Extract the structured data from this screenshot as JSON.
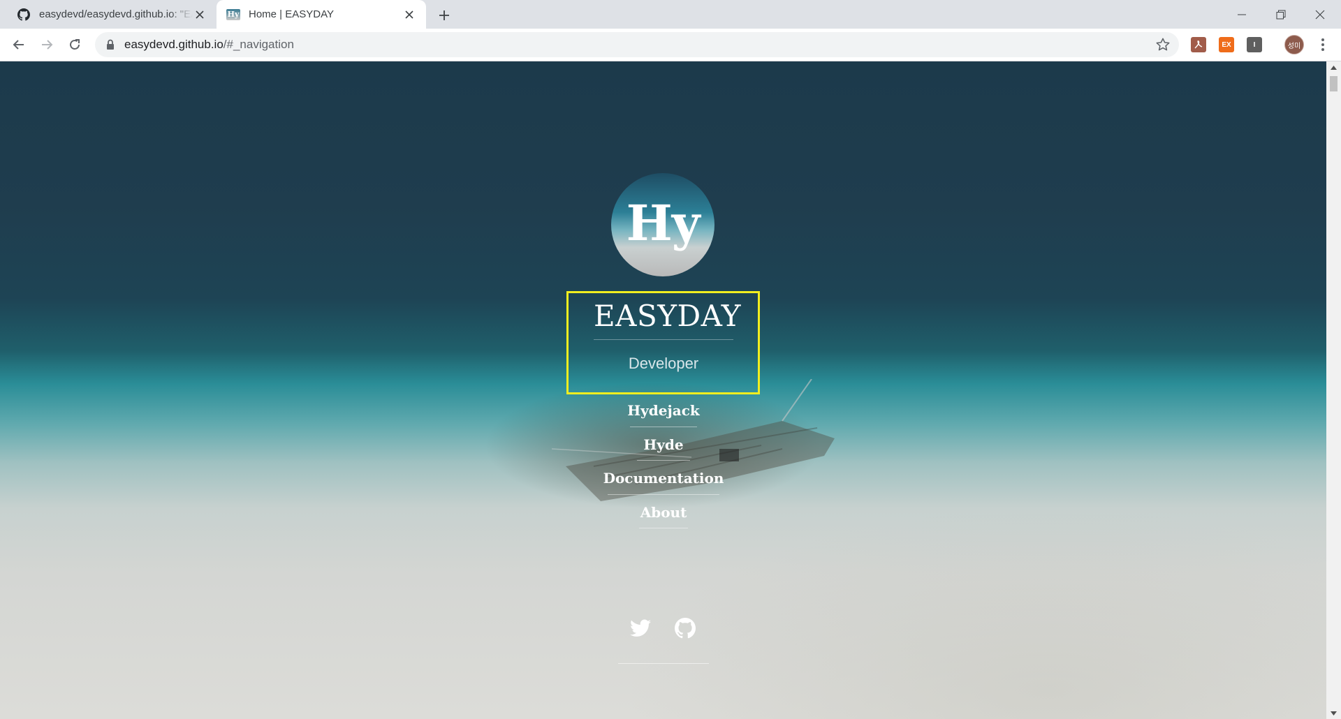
{
  "browser": {
    "tabs": [
      {
        "title": "easydevd/easydevd.github.io: \"EASYDAY\"",
        "favicon": "github-icon",
        "active": false
      },
      {
        "title": "Home | EASYDAY",
        "favicon": "hy-icon",
        "favicon_text": "Hy",
        "active": true
      }
    ],
    "address": {
      "host": "easydevd.github.io",
      "path": "/#_navigation"
    },
    "extensions": [
      {
        "name": "pdf-extension-icon",
        "color": "#a15c4a"
      },
      {
        "name": "ex-extension-icon",
        "label": "EX",
        "color": "#ef6c1a"
      },
      {
        "name": "reader-extension-icon",
        "label": "I",
        "color": "#5f5f5f"
      }
    ],
    "profile_label": "성미"
  },
  "page": {
    "avatar_text": "Hy",
    "site_title": "EASYDAY",
    "tagline": "Developer",
    "nav": [
      "Hydejack",
      "Hyde",
      "Documentation",
      "About"
    ],
    "social": [
      "twitter-icon",
      "github-icon"
    ],
    "highlight_color": "#f2ee1f"
  }
}
